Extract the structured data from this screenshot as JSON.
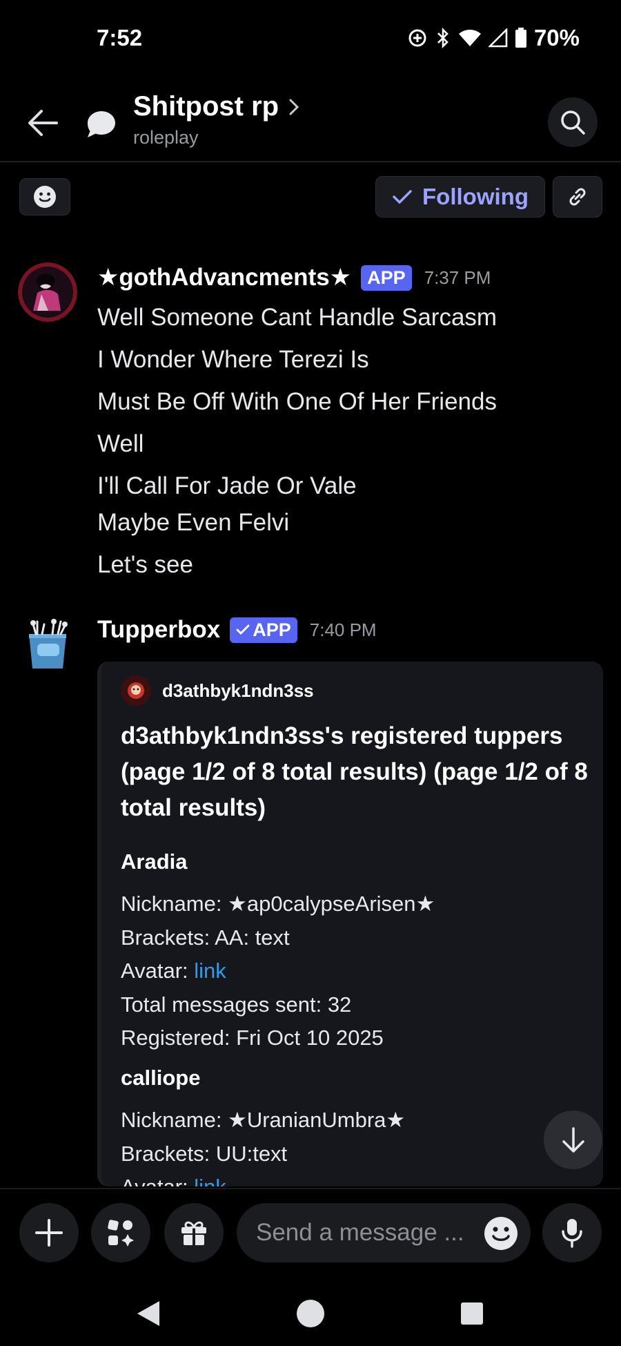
{
  "status_bar": {
    "time": "7:52",
    "battery": "70%"
  },
  "header": {
    "title": "Shitpost rp",
    "subtitle": "roleplay"
  },
  "toolbar": {
    "following_label": "Following"
  },
  "messages": [
    {
      "author": "★gothAdvancments★",
      "badge": "APP",
      "time": "7:37 PM",
      "lines": [
        "Well Someone Cant Handle Sarcasm",
        "I Wonder Where Terezi Is",
        "Must Be Off With One Of Her Friends",
        "Well",
        "I'll Call For Jade Or Vale",
        "Maybe Even Felvi",
        "Let's see"
      ]
    },
    {
      "author": "Tupperbox",
      "badge": "APP",
      "time": "7:40 PM",
      "embed": {
        "author": "d3athbyk1ndn3ss",
        "title": "d3athbyk1ndn3ss's registered tuppers (page 1/2 of 8 total results) (page 1/2 of 8 total results)",
        "fields": [
          {
            "name": "Aradia",
            "nickname": "Nickname: ★ap0calypseArisen★",
            "brackets": "Brackets: AA: text",
            "avatar_prefix": "Avatar: ",
            "avatar_link": "link",
            "total": "Total messages sent: 32",
            "registered": "Registered: Fri Oct 10 2025"
          },
          {
            "name": "calliope",
            "nickname": "Nickname: ★UranianUmbra★",
            "brackets": "Brackets: UU:text",
            "avatar_prefix": "Avatar: ",
            "avatar_link": "link"
          }
        ]
      }
    }
  ],
  "composer": {
    "placeholder": "Send a message ..."
  },
  "colors": {
    "accent": "#5865f2",
    "following_text": "#9ba3ff",
    "link": "#2d9dea",
    "background": "#000000"
  }
}
